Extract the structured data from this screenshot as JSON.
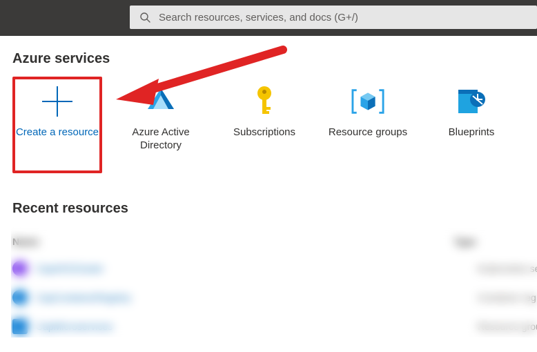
{
  "search": {
    "placeholder": "Search resources, services, and docs (G+/)"
  },
  "sections": {
    "services_title": "Azure services",
    "recent_title": "Recent resources"
  },
  "tiles": {
    "create": {
      "label": "Create a resource"
    },
    "aad": {
      "label": "Azure Active Directory"
    },
    "subscriptions": {
      "label": "Subscriptions"
    },
    "rg": {
      "label": "Resource groups"
    },
    "blueprints": {
      "label": "Blueprints"
    }
  },
  "recent": {
    "headers": {
      "name": "Name",
      "type": "Type"
    },
    "rows": [
      {
        "name": "CapAKSCluster",
        "type": "Kubernetes se",
        "swatch": "#7c3aed",
        "shape": "circle"
      },
      {
        "name": "CapContainerRegistry",
        "type": "Container reg",
        "swatch": "#0078d4",
        "shape": "circle"
      },
      {
        "name": "CapMicroservices",
        "type": "Resource grou",
        "swatch": "#0078d4",
        "shape": "square"
      }
    ]
  },
  "annotation": {
    "color": "#e02424"
  }
}
